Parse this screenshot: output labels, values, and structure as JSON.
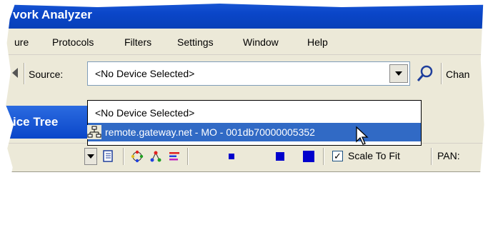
{
  "window": {
    "title": "vork Analyzer"
  },
  "menu": {
    "items": [
      "ure",
      "Protocols",
      "Filters",
      "Settings",
      "Window",
      "Help"
    ]
  },
  "toolbar": {
    "source_label": "Source:",
    "source_value": "<No Device Selected>",
    "right_clip_label": "Chan"
  },
  "dropdown": {
    "options": [
      {
        "label": "<No Device Selected>",
        "icon": "none",
        "selected": false
      },
      {
        "label": "remote.gateway.net - MO - 001db70000005352",
        "icon": "network-tree-icon",
        "selected": true
      }
    ]
  },
  "panel": {
    "title": "ice Tree"
  },
  "view_toolbar": {
    "scale_to_fit_label": "Scale To Fit",
    "scale_to_fit_checked": true,
    "pan_label": "PAN:"
  },
  "colors": {
    "titlebar": "#0a46c9",
    "selection": "#316ac5",
    "size_squares": "#0000cc"
  }
}
